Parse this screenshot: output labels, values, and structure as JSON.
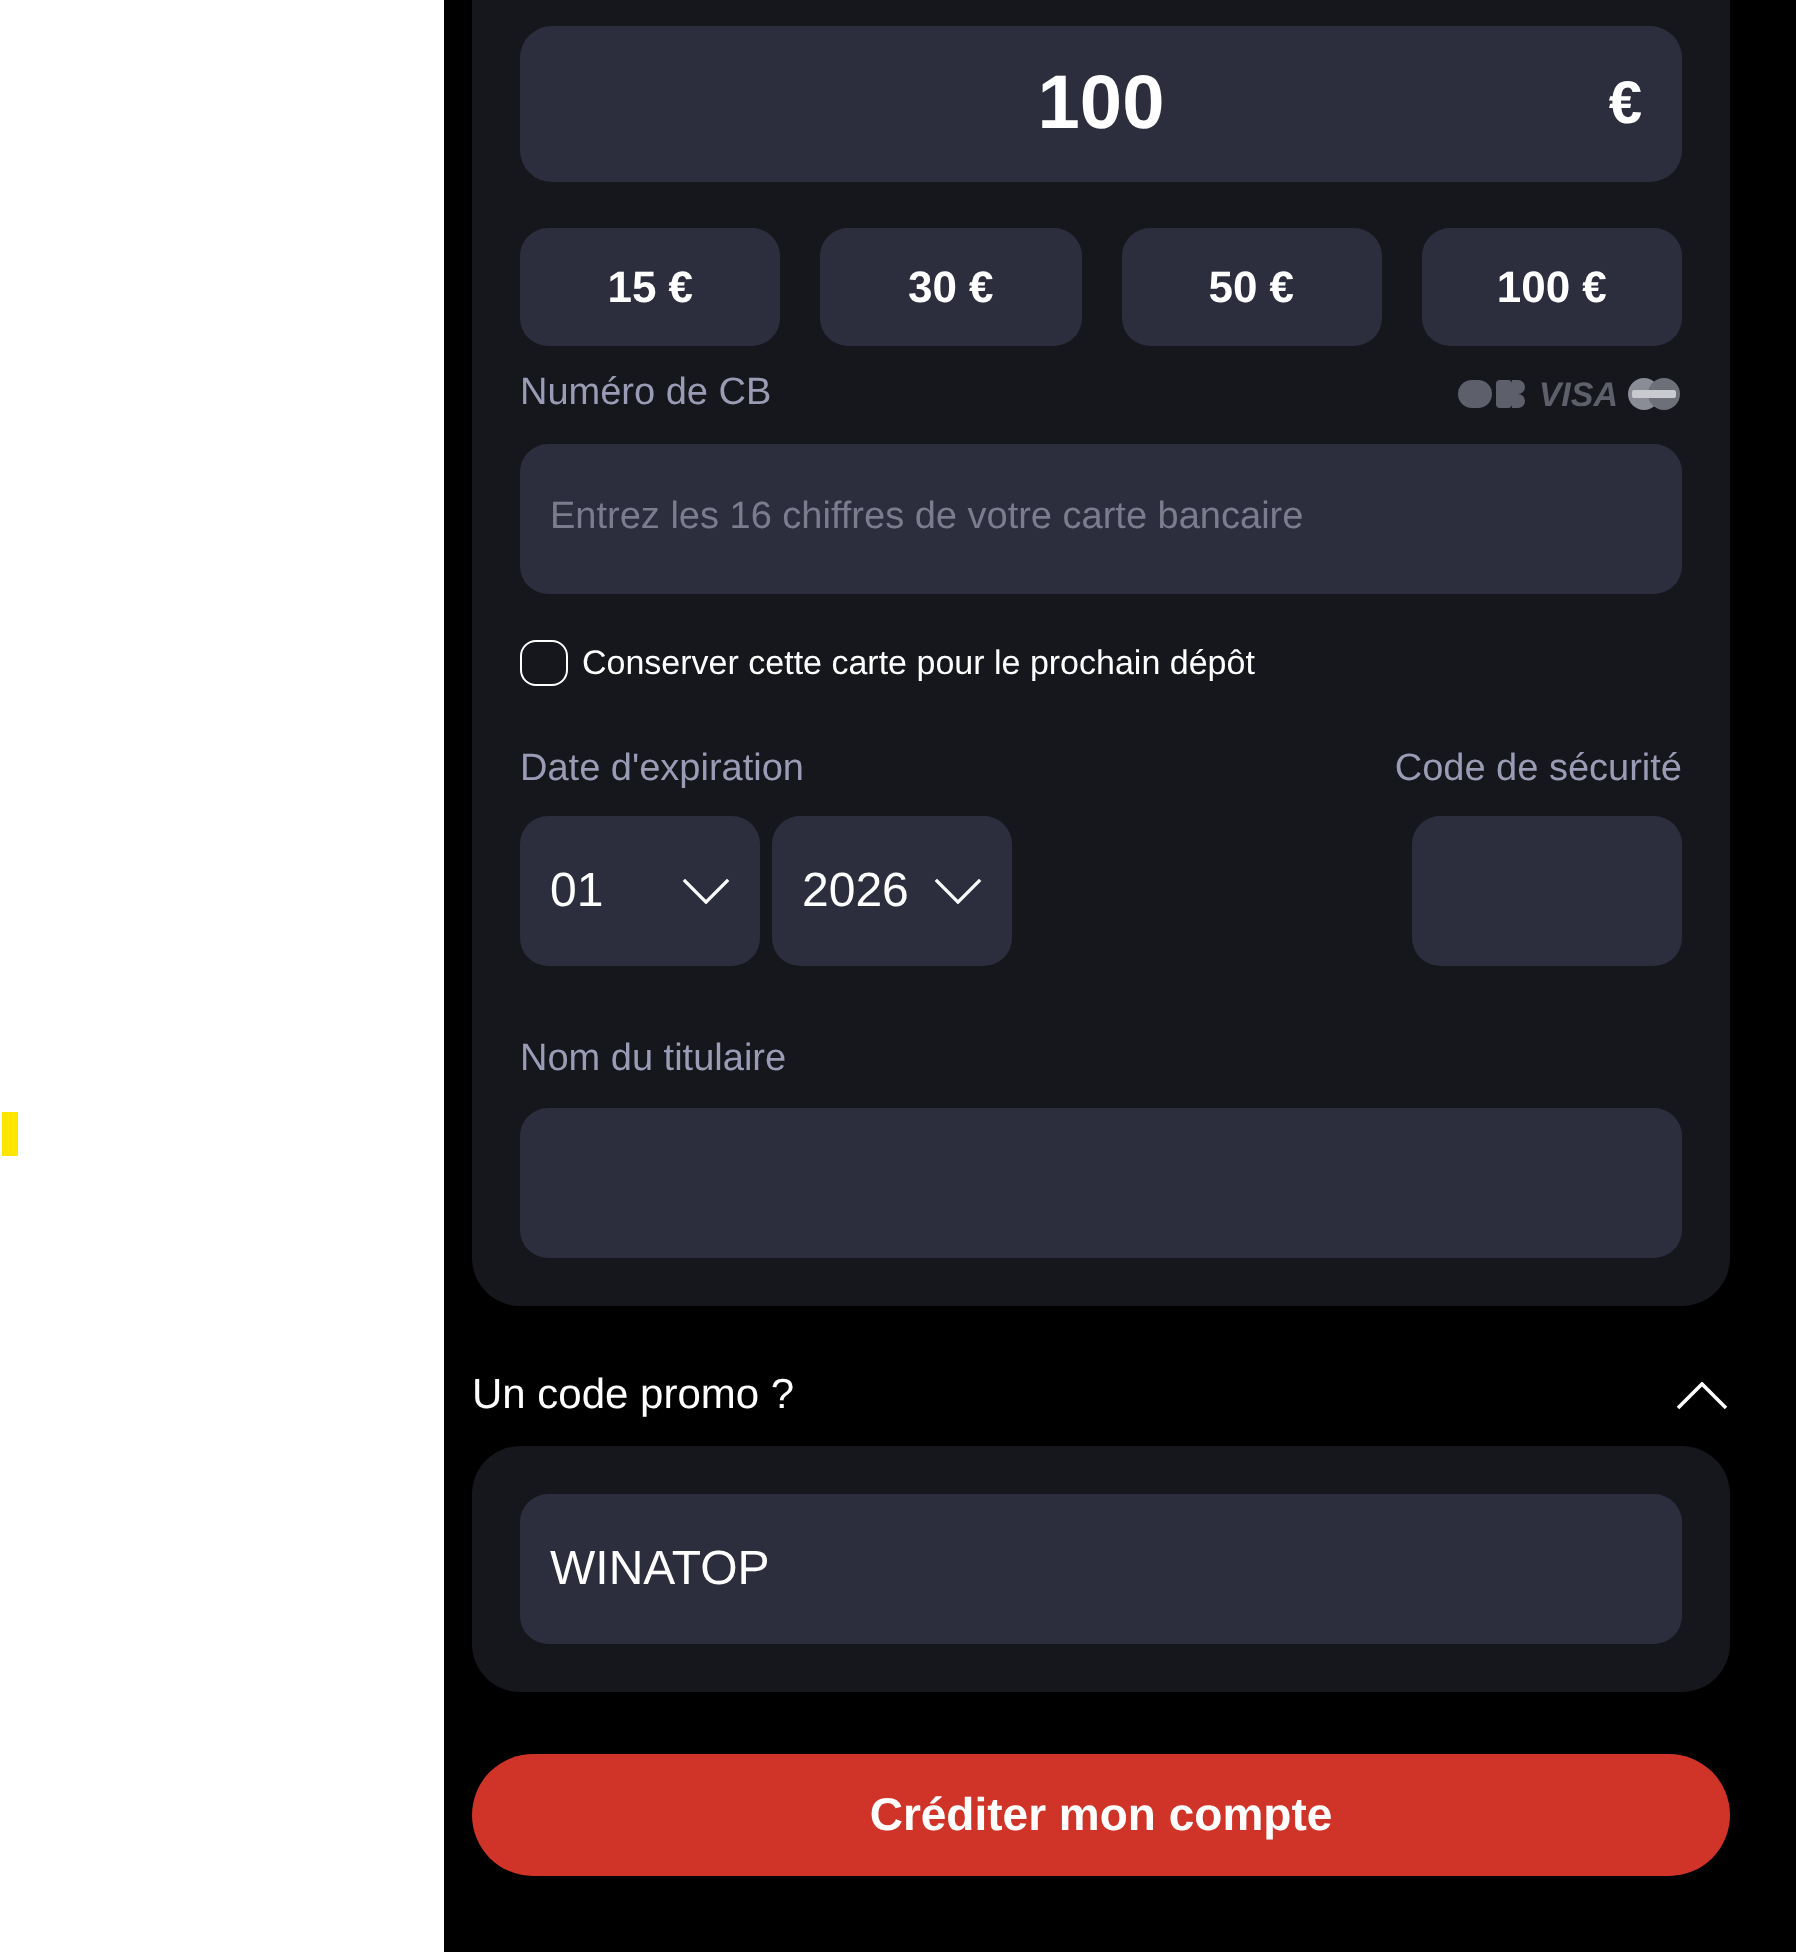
{
  "amount": {
    "value": "100",
    "currency": "€"
  },
  "presets": [
    "15 €",
    "30 €",
    "50 €",
    "100 €"
  ],
  "card_number": {
    "label": "Numéro de CB",
    "brand_text": "VISA",
    "placeholder": "Entrez les 16 chiffres de votre carte bancaire"
  },
  "save_card": {
    "label": "Conserver cette carte pour le prochain dépôt",
    "checked": false
  },
  "expiry": {
    "label": "Date d'expiration",
    "month": "01",
    "year": "2026"
  },
  "security_code": {
    "label": "Code de sécurité"
  },
  "holder": {
    "label": "Nom du titulaire"
  },
  "promo": {
    "title": "Un code promo ?",
    "expanded": true,
    "value": "WINATOP"
  },
  "submit": "Créditer mon compte"
}
